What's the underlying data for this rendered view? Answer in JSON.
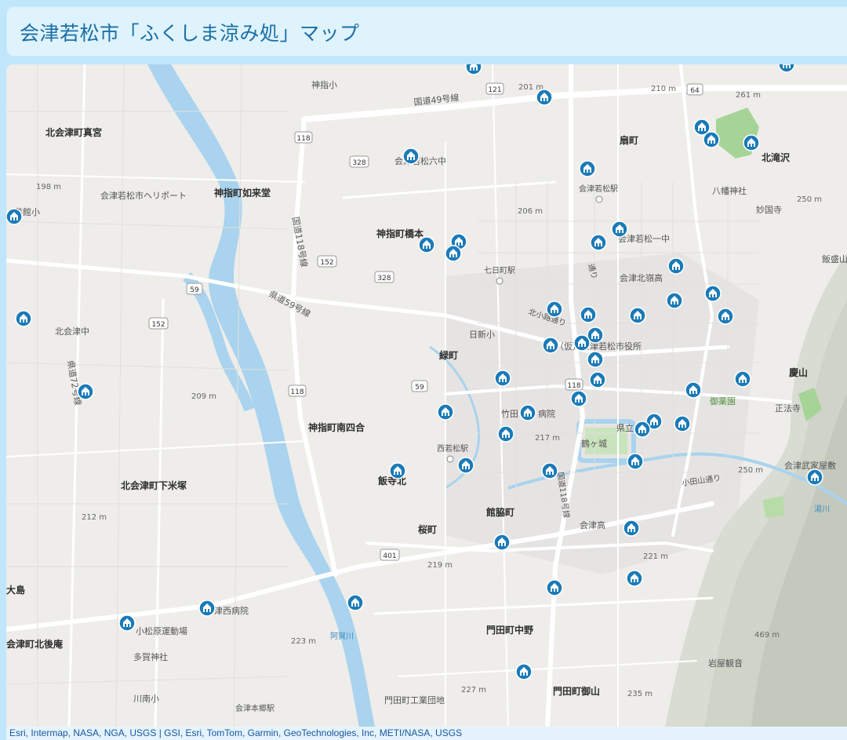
{
  "page": {
    "title": "会津若松市「ふくしま涼み処」マップ"
  },
  "attribution": "Esri, Intermap, NASA, NGA, USGS | GSI, Esri, TomTom, Garmin, GeoTechnologies, Inc, METI/NASA, USGS",
  "colors": {
    "background": "#bfe6fb",
    "title_bar": "#dff3fd",
    "title_text": "#1b6fa6",
    "marker": "#1a7ab8",
    "water": "#a9d3ee",
    "land": "#eeedea",
    "park": "#a6d497"
  },
  "map": {
    "icon_name": "cooling-shelter-marker-icon",
    "labels": {
      "kitaaizu_mamiya": "北会津町真宮",
      "heliport": "会津若松市ヘリポート",
      "kodate_kozaki": "神指町如来堂",
      "kamisashi_sho": "神指小",
      "kokudo49": "国道49号線",
      "rokuchu": "会津若松六中",
      "hashimoto": "神指町橋本",
      "kokudo118": "国道118号線",
      "kendo59": "県道59号線",
      "kitaaizu_chu": "北会津中",
      "kendo72": "県道72号線",
      "kamisashi_minami": "神指町南四合",
      "iideraki": "飯寺北",
      "kitaaizu_shimoyoneduka": "北会津町下米塚",
      "midorimachi": "緑町",
      "nisshin_sho": "日新小",
      "nanukamachi_eki": "七日町駅",
      "kitakoji": "北小路通り",
      "shiyakusho": "（仮）会津若松市役所",
      "takeda": "竹田",
      "byoin": "病院",
      "nishiwakamatsu_eki": "西若松駅",
      "tsurugajo": "鶴ヶ城",
      "kenritsu": "県立",
      "sakuramachi": "桜町",
      "tatewakimachi": "館脇町",
      "aizu_ko": "会津高",
      "kokudo118b": "国道118号線",
      "ogawa_dori": "小田山通り",
      "ogawa_label": "御薬園",
      "monden_nakano": "門田町中野",
      "monden_gyosan": "門田町御山",
      "monden_kogyo": "門田町工業団地",
      "aga_gawa": "阿賀川",
      "ohashi": "大島",
      "kitagoan": "会津町北後庵",
      "tsunishi_byoin": "津西病院",
      "koharuhara": "小松原運動場",
      "taga_jinja": "多賀神社",
      "kawaminami_sho": "川南小",
      "aizuhongo_eki": "会津本郷駅",
      "hokushin_ko": "養館小",
      "omachi": "扇町",
      "aizuwakamatsu_eki": "会津若松駅",
      "hachiman": "八幡神社",
      "myokokuji": "妙国寺",
      "kitatakizawa": "北滝沢",
      "iimoriyama": "飯盛山",
      "aizu_ichichu": "会津若松一中",
      "kitarei_ko": "会津北嶺高",
      "keizan": "慶山",
      "shoboji": "正法寺",
      "bukeyashiki": "会津武家屋敷",
      "iwaya_kannon": "岩屋観音",
      "ki": "湯川",
      "e198": "198 m",
      "e201": "201 m",
      "e206": "206 m",
      "e209": "209 m",
      "e210": "210 m",
      "e212": "212 m",
      "e217": "217 m",
      "e219": "219 m",
      "e221": "221 m",
      "e223": "223 m",
      "e227": "227 m",
      "e235": "235 m",
      "e250a": "250 m",
      "e250b": "250 m",
      "e261": "261 m",
      "e469": "469 m",
      "r121": "121",
      "r64": "64",
      "r118a": "118",
      "r328a": "328",
      "r152a": "152",
      "r328b": "328",
      "r59a": "59",
      "r152b": "152",
      "r59b": "59",
      "r118b": "118",
      "r118c": "118",
      "r401": "401",
      "yama": "山",
      "rosen": "線",
      "doori": "通り",
      "kita": "北"
    }
  }
}
